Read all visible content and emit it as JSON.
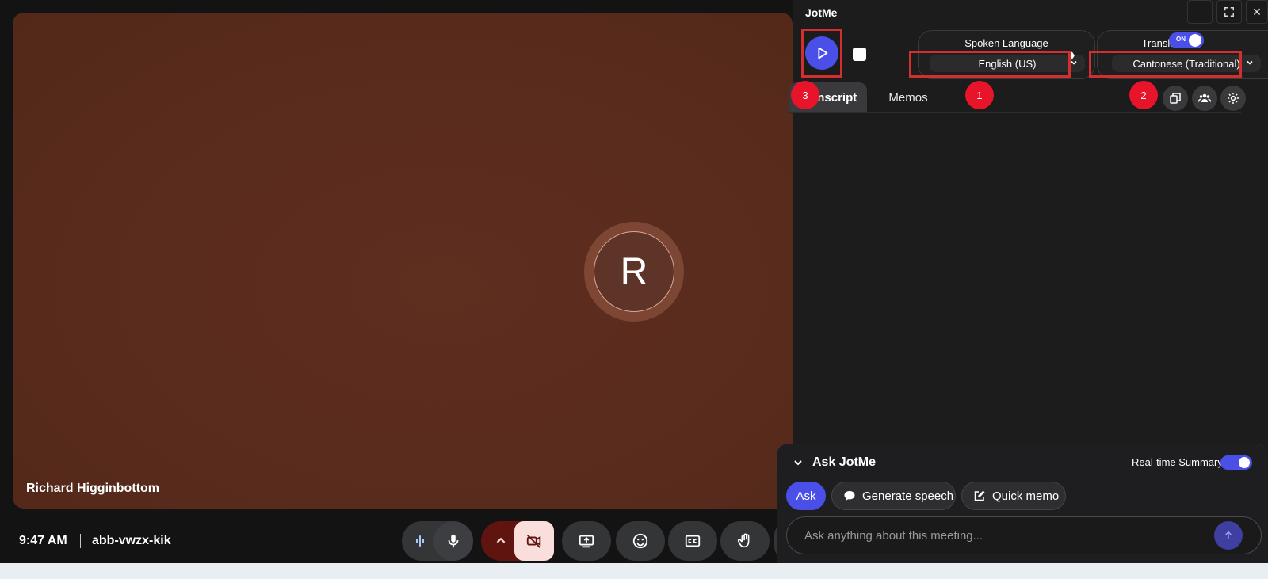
{
  "meet": {
    "avatar_letter": "R",
    "participant_name": "Richard Higginbottom",
    "time": "9:47 AM",
    "meeting_code": "abb-vwzx-kik"
  },
  "jotme": {
    "title": "JotMe",
    "spoken_language": {
      "label": "Spoken Language",
      "value": "English (US)"
    },
    "translation": {
      "label": "Translation",
      "toggle": "ON",
      "value": "Cantonese (Traditional)"
    },
    "tabs": [
      {
        "label": "Transcript"
      },
      {
        "label": "Memos"
      }
    ],
    "badges": [
      "1",
      "2",
      "3"
    ],
    "ask": {
      "title": "Ask JotMe",
      "realtime_label": "Real-time Summary",
      "ask_button": "Ask",
      "generate_button": "Generate speech",
      "memo_button": "Quick memo",
      "placeholder": "Ask anything about this meeting..."
    }
  },
  "colors": {
    "accent": "#4a4fe8",
    "highlight_red": "#d32f2f",
    "badge_red": "#e8152a",
    "tile_brown": "#5a2c1e"
  }
}
